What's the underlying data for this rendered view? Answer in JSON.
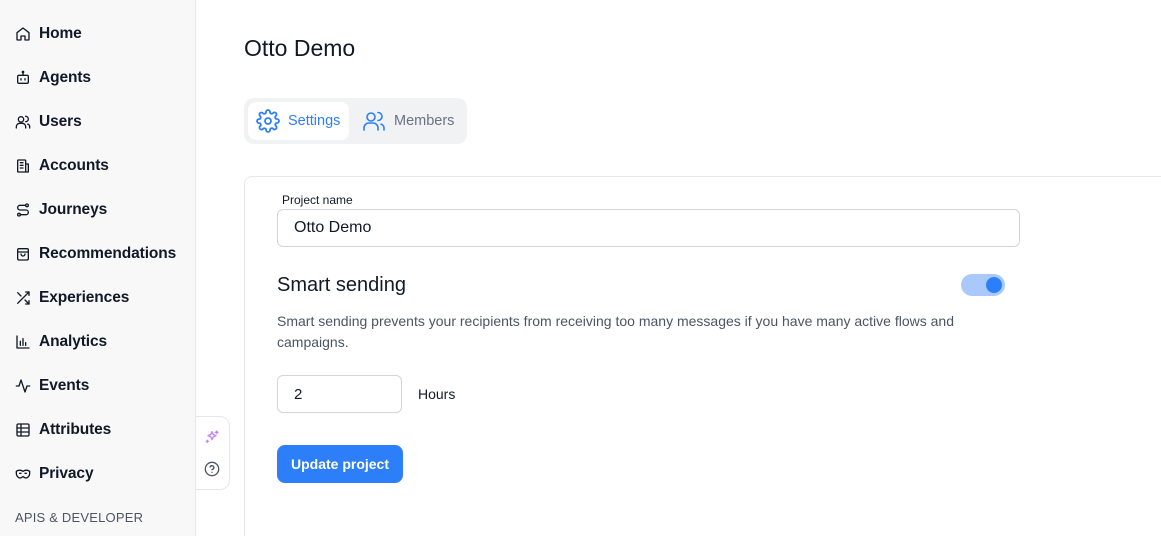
{
  "sidebar": {
    "items": [
      {
        "label": "Home",
        "icon": "home-icon"
      },
      {
        "label": "Agents",
        "icon": "robot-icon"
      },
      {
        "label": "Users",
        "icon": "users-icon"
      },
      {
        "label": "Accounts",
        "icon": "building-icon"
      },
      {
        "label": "Journeys",
        "icon": "route-icon"
      },
      {
        "label": "Recommendations",
        "icon": "shopping-bag-icon"
      },
      {
        "label": "Experiences",
        "icon": "shuffle-icon"
      },
      {
        "label": "Analytics",
        "icon": "bar-chart-icon"
      },
      {
        "label": "Events",
        "icon": "activity-icon"
      },
      {
        "label": "Attributes",
        "icon": "table-icon"
      },
      {
        "label": "Privacy",
        "icon": "mask-icon"
      }
    ],
    "section_label": "APIS & DEVELOPER"
  },
  "tools": {
    "ai_icon": "sparkles-icon",
    "help_icon": "help-circle-icon"
  },
  "main": {
    "title": "Otto Demo",
    "tabs": [
      {
        "label": "Settings",
        "icon": "gear-icon",
        "active": true
      },
      {
        "label": "Members",
        "icon": "users-icon",
        "active": false
      }
    ]
  },
  "form": {
    "project_name_label": "Project name",
    "project_name_value": "Otto Demo",
    "smart_sending_title": "Smart sending",
    "smart_sending_enabled": true,
    "smart_sending_description": "Smart sending prevents your recipients from receiving too many messages if you have many active flows and campaigns.",
    "hours_value": "2",
    "hours_label": "Hours",
    "submit_label": "Update project"
  },
  "colors": {
    "accent": "#2d7ff9",
    "toggle_track": "#a9c9fb",
    "sidebar_bg": "#f8f8f9"
  }
}
